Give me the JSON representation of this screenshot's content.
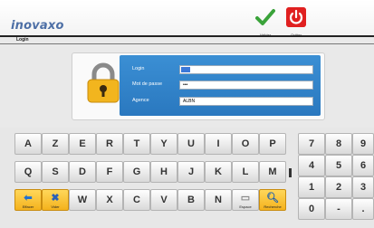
{
  "header": {
    "logo_text": "inovaxo",
    "validate_label": "Valider",
    "quit_label": "Quitter"
  },
  "breadcrumb": "Login",
  "login": {
    "login_label": "Login",
    "login_value": "",
    "password_label": "Mot de passe",
    "password_value": "•••",
    "agency_label": "Agence",
    "agency_value": "ALBN"
  },
  "keyboard": {
    "row1": [
      "A",
      "Z",
      "E",
      "R",
      "T",
      "Y",
      "U",
      "I",
      "O",
      "P"
    ],
    "row2": [
      "Q",
      "S",
      "D",
      "F",
      "G",
      "H",
      "J",
      "K",
      "L",
      "M"
    ],
    "row3": [
      "W",
      "X",
      "C",
      "V",
      "B",
      "N"
    ],
    "erase_label": "Effacer",
    "clear_label": "Vider",
    "space_label": "Espace",
    "search_label": "Recherche",
    "numpad": [
      "7",
      "8",
      "9",
      "4",
      "5",
      "6",
      "1",
      "2",
      "3",
      "0",
      "-",
      "."
    ]
  },
  "colors": {
    "panel_blue": "#2f83c8",
    "key_orange": "#f4b21d",
    "quit_red": "#e02020",
    "check_green": "#3aa33a"
  }
}
